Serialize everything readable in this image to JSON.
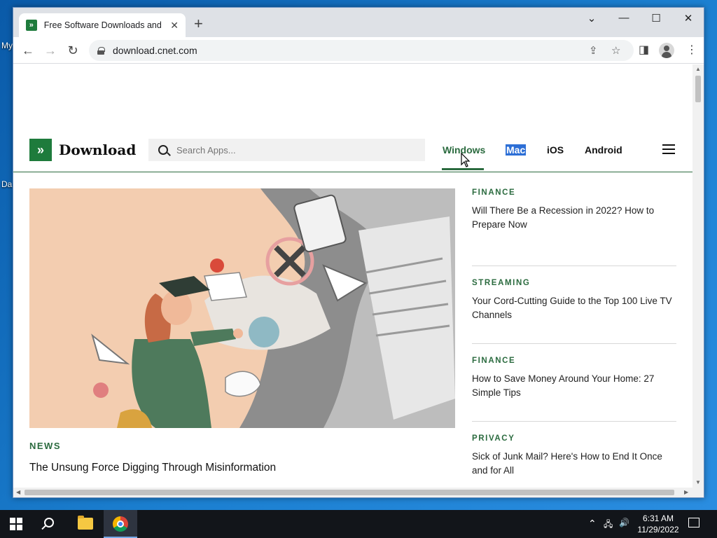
{
  "desktop": {
    "labels": [
      "My",
      "Da"
    ]
  },
  "browser": {
    "tab": {
      "favicon": "»",
      "title": "Free Software Downloads and Re",
      "close_icon": "✕"
    },
    "new_tab_icon": "+",
    "window_controls": {
      "dropdown": "⌄",
      "minimize": "—",
      "maximize": "☐",
      "close": "✕"
    },
    "nav": {
      "back": "←",
      "forward": "→",
      "reload": "↻"
    },
    "url": "download.cnet.com",
    "icons": {
      "share": "⇪",
      "bookmark": "☆",
      "sidepanel": "◨",
      "menu": "⋮"
    }
  },
  "site": {
    "logo_mark": "»",
    "logo_text": "Download",
    "search_placeholder": "Search Apps...",
    "platforms": [
      "Windows",
      "Mac",
      "iOS",
      "Android"
    ],
    "active_platform": "Windows",
    "hero": {
      "category": "NEWS",
      "title": "The Unsung Force Digging Through Misinformation"
    },
    "sidebar": [
      {
        "category": "FINANCE",
        "title": "Will There Be a Recession in 2022? How to Prepare Now"
      },
      {
        "category": "STREAMING",
        "title": "Your Cord-Cutting Guide to the Top 100 Live TV Channels"
      },
      {
        "category": "FINANCE",
        "title": "How to Save Money Around Your Home: 27 Simple Tips"
      },
      {
        "category": "PRIVACY",
        "title": "Sick of Junk Mail? Here's How to End It Once and for All"
      }
    ],
    "colors": {
      "brand_green": "#1e7b3c",
      "category_green": "#2b6b3f",
      "hero_bg": "#f3cdb0"
    }
  },
  "taskbar": {
    "tray": {
      "chevron": "⌃",
      "network": "🖧",
      "volume": "🔊"
    },
    "time": "6:31 AM",
    "date": "11/29/2022"
  }
}
